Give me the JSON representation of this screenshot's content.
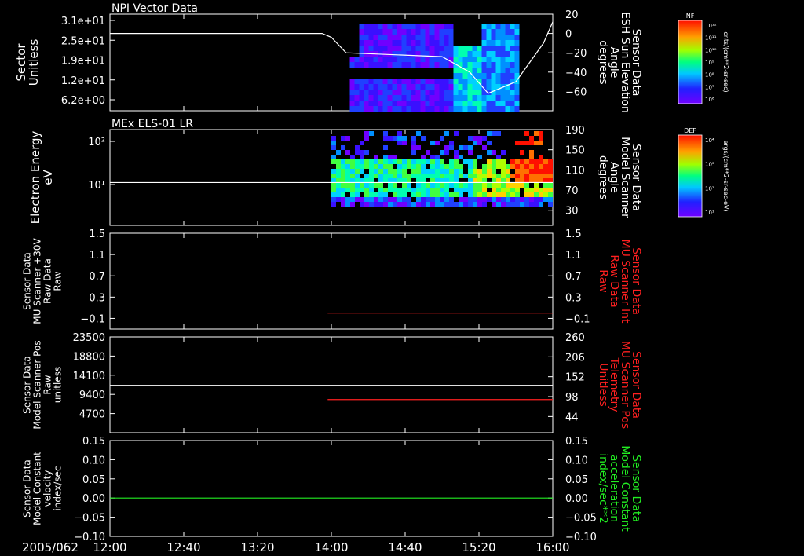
{
  "colors": {
    "white": "#ffffff",
    "red": "#ff2020",
    "green": "#22ee22",
    "bg": "#000000"
  },
  "time_axis": {
    "date_label": "2005/062",
    "ticks": [
      "12:00",
      "12:40",
      "13:20",
      "14:00",
      "14:40",
      "15:20",
      "16:00"
    ]
  },
  "colorbars": [
    {
      "code": "NF",
      "unit": "cnts/(cm**2-sr-sec)",
      "ticks": [
        "10¹²",
        "10¹¹",
        "10¹⁰",
        "10⁹",
        "10⁸",
        "10⁷",
        "10⁶"
      ]
    },
    {
      "code": "DEF",
      "unit": "ergs/(cm**2-sr-sec-eV)",
      "ticks": [
        "10⁴",
        "10³",
        "10²",
        "10¹"
      ]
    }
  ],
  "chart_data": [
    {
      "type": "heatmap",
      "title": "NPI Vector Data",
      "ylabel": [
        "Sector",
        "Unitless"
      ],
      "yticks": [
        "3.1e+01",
        "2.5e+01",
        "1.9e+01",
        "1.2e+01",
        "6.2e+00"
      ],
      "y2label": [
        "Sensor Data",
        "ESH Sun Elevation",
        "Angle",
        "degrees"
      ],
      "y2ticks": [
        "20",
        "0",
        "−20",
        "−40",
        "−60"
      ],
      "y2lim": [
        -80,
        20
      ],
      "data_time_range": [
        "14:10",
        "15:40"
      ],
      "overlay_line": {
        "axis": "y2",
        "x": [
          "12:00",
          "13:55",
          "14:00",
          "14:08",
          "15:00",
          "15:15",
          "15:25",
          "15:40",
          "15:55",
          "16:00"
        ],
        "y": [
          0,
          0,
          -4,
          -20,
          -24,
          -40,
          -62,
          -50,
          -10,
          12
        ]
      }
    },
    {
      "type": "heatmap",
      "title": "MEx ELS-01 LR",
      "ylabel": [
        "Electron Energy",
        "eV"
      ],
      "yticks": [
        "10²",
        "10¹"
      ],
      "ylog": true,
      "y2label": [
        "Sensor Data",
        "Model Scanner",
        "Angle",
        "degrees"
      ],
      "y2ticks": [
        "190",
        "150",
        "110",
        "70",
        "30"
      ],
      "y2lim": [
        0,
        190
      ],
      "data_time_range": [
        "14:00",
        "16:00"
      ],
      "overlay_line": {
        "axis": "y2",
        "x": [
          "12:00",
          "16:00"
        ],
        "y": [
          85,
          85
        ]
      }
    },
    {
      "type": "line",
      "ylabel": [
        "Sensor Data",
        "MU Scanner +30V",
        "Raw Data",
        "Raw"
      ],
      "yticks": [
        "1.5",
        "1.1",
        "0.7",
        "0.3",
        "−0.1"
      ],
      "ylim": [
        -0.3,
        1.5
      ],
      "y2label": [
        "Sensor Data",
        "MU Scanner Int",
        "Raw Data",
        "Raw"
      ],
      "y2ticks": [
        "1.5",
        "1.1",
        "0.7",
        "0.3",
        "−0.1"
      ],
      "series": [
        {
          "axis": "y2",
          "color": "red",
          "x": [
            "13:58",
            "16:00"
          ],
          "y": [
            0,
            0
          ]
        }
      ]
    },
    {
      "type": "line",
      "ylabel": [
        "Sensor Data",
        "Model Scanner Pos",
        "Raw",
        "unitless"
      ],
      "yticks": [
        "23500",
        "18800",
        "14100",
        "9400",
        "4700"
      ],
      "ylim": [
        0,
        23500
      ],
      "y2label": [
        "Sensor Data",
        "MU Scanner Pos",
        "Telemetry",
        "Unitless"
      ],
      "y2ticks": [
        "260",
        "206",
        "152",
        "98",
        "44"
      ],
      "y2lim": [
        0,
        260
      ],
      "series": [
        {
          "axis": "y",
          "color": "white",
          "x": [
            "12:00",
            "16:00"
          ],
          "y": [
            11600,
            11600
          ]
        },
        {
          "axis": "y2",
          "color": "red",
          "x": [
            "13:58",
            "16:00"
          ],
          "y": [
            90,
            90
          ]
        }
      ]
    },
    {
      "type": "line",
      "ylabel": [
        "Sensor Data",
        "Model Constant",
        "velocity",
        "index/sec"
      ],
      "yticks": [
        "0.15",
        "0.10",
        "0.05",
        "0.00",
        "−0.05",
        "−0.10"
      ],
      "ylim": [
        -0.1,
        0.15
      ],
      "y2label": [
        "Sensor Data",
        "Model Constant",
        "acceleration",
        "index/sec**2"
      ],
      "y2ticks": [
        "0.15",
        "0.10",
        "0.05",
        "0.00",
        "−0.05",
        "−0.10"
      ],
      "series": [
        {
          "axis": "y",
          "color": "green",
          "x": [
            "12:00",
            "16:00"
          ],
          "y": [
            0,
            0
          ]
        }
      ]
    }
  ]
}
